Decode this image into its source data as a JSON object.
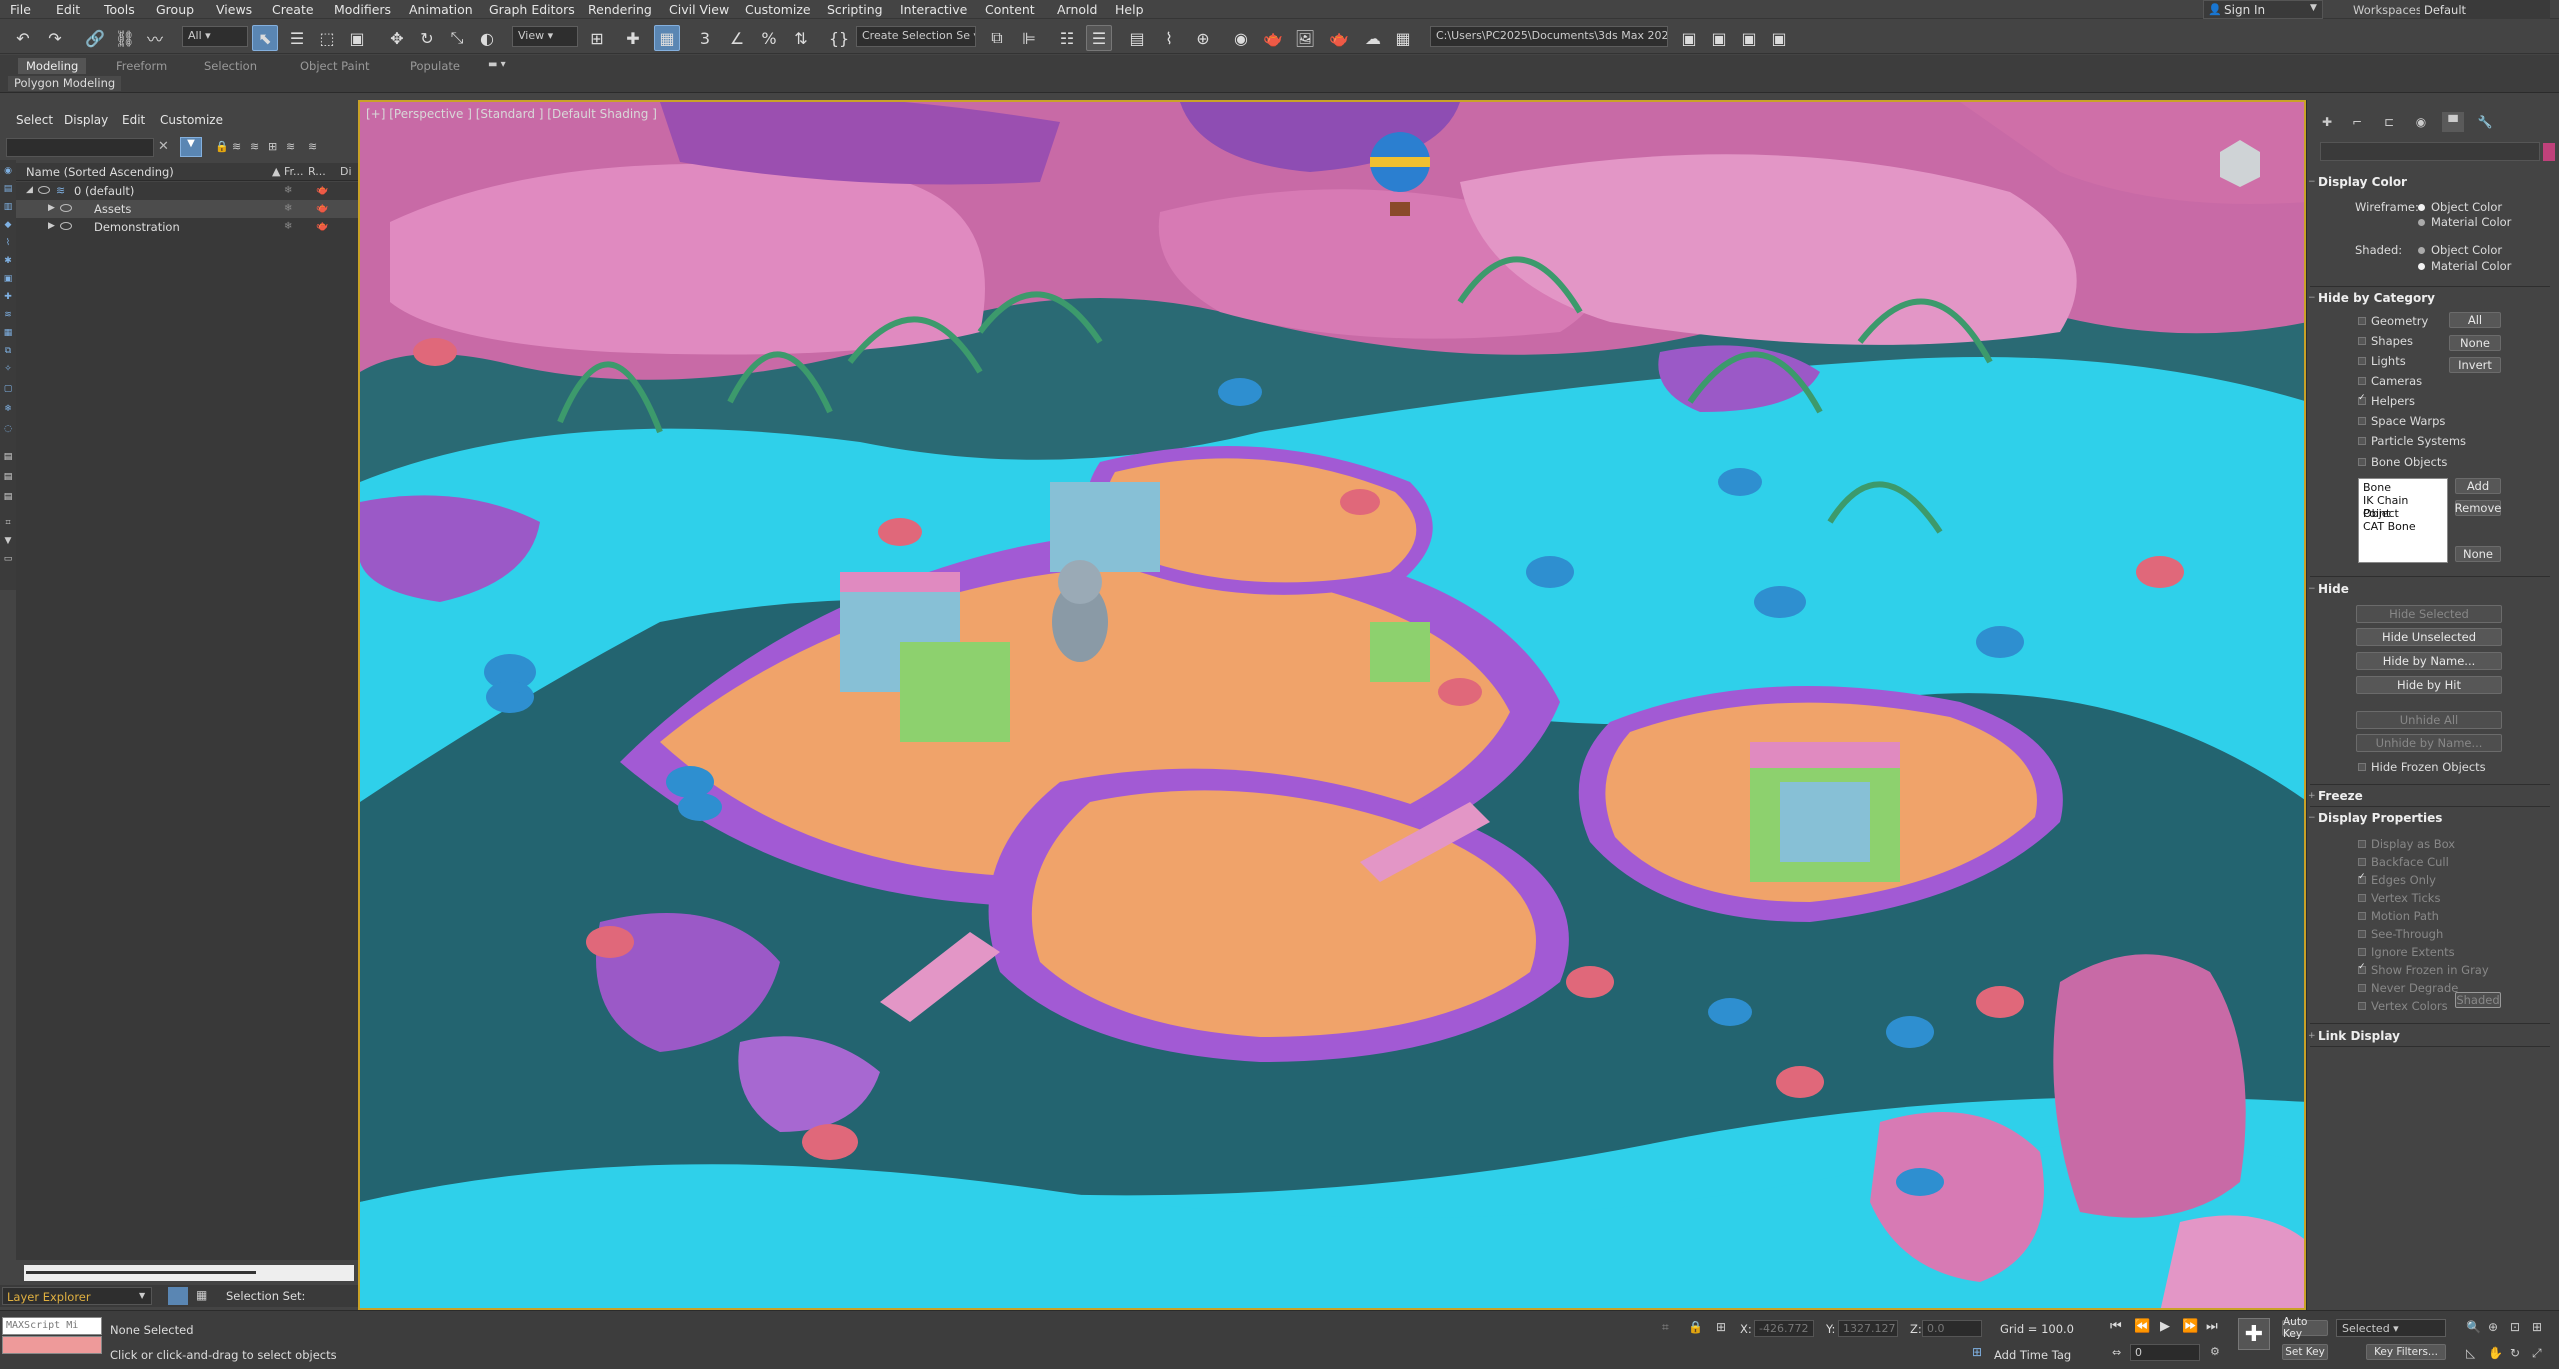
{
  "menubar": {
    "items": [
      "File",
      "Edit",
      "Tools",
      "Group",
      "Views",
      "Create",
      "Modifiers",
      "Animation",
      "Graph Editors",
      "Rendering",
      "Civil View",
      "Customize",
      "Scripting",
      "Interactive",
      "Content",
      "Arnold",
      "Help"
    ],
    "sign_in": "Sign In",
    "workspaces_label": "Workspaces:",
    "workspace": "Default"
  },
  "toolbar": {
    "filter": "All",
    "refcoord": "View",
    "selection_set": "Create Selection Se",
    "project_path": "C:\\Users\\PC2025\\Documents\\3ds Max 2020"
  },
  "ribbon": {
    "tabs": [
      "Modeling",
      "Freeform",
      "Selection",
      "Object Paint",
      "Populate"
    ],
    "sub": "Polygon Modeling"
  },
  "explorer": {
    "menu": [
      "Select",
      "Display",
      "Edit",
      "Customize"
    ],
    "header": "Name (Sorted Ascending)",
    "col_frozen": "▲ Fr...",
    "col_render": "R...",
    "col_display": "Di",
    "rows": [
      {
        "name": "0 (default)",
        "level": 0
      },
      {
        "name": "Assets",
        "level": 1
      },
      {
        "name": "Demonstration",
        "level": 1
      }
    ],
    "layer_explorer": "Layer Explorer",
    "selection_set": "Selection Set:"
  },
  "viewport": {
    "label": "[+] [Perspective ] [Standard ] [Default Shading ]"
  },
  "cmdpanel": {
    "display_color": {
      "title": "Display Color",
      "wireframe": "Wireframe:",
      "shaded": "Shaded:",
      "object_color": "Object Color",
      "material_color": "Material Color"
    },
    "hide_by_category": {
      "title": "Hide by Category",
      "items": [
        "Geometry",
        "Shapes",
        "Lights",
        "Cameras",
        "Helpers",
        "Space Warps",
        "Particle Systems",
        "Bone Objects"
      ],
      "checked_index": 4,
      "all": "All",
      "none": "None",
      "invert": "Invert",
      "list": [
        "Bone",
        "IK Chain Object",
        "Point",
        "CAT Bone"
      ],
      "add": "Add",
      "remove": "Remove",
      "none2": "None"
    },
    "hide": {
      "title": "Hide",
      "hide_selected": "Hide Selected",
      "hide_unselected": "Hide Unselected",
      "hide_by_name": "Hide by Name...",
      "hide_by_hit": "Hide by Hit",
      "unhide_all": "Unhide All",
      "unhide_by_name": "Unhide by Name...",
      "hide_frozen": "Hide Frozen Objects"
    },
    "freeze": {
      "title": "Freeze"
    },
    "display_properties": {
      "title": "Display Properties",
      "items": [
        "Display as Box",
        "Backface Cull",
        "Edges Only",
        "Vertex Ticks",
        "Motion Path",
        "See-Through",
        "Ignore Extents",
        "Show Frozen in Gray",
        "Never Degrade",
        "Vertex Colors"
      ],
      "shaded_btn": "Shaded"
    },
    "link_display": {
      "title": "Link Display"
    }
  },
  "statusbar": {
    "maxscript": "MAXScript Mi",
    "none_selected": "None Selected",
    "prompt": "Click or click-and-drag to select objects",
    "x_label": "X:",
    "x": "-426.772",
    "y_label": "Y:",
    "y": "1327.127",
    "z_label": "Z:",
    "z": "0.0",
    "grid": "Grid = 100.0",
    "add_time_tag": "Add Time Tag",
    "auto_key": "Auto Key",
    "set_key": "Set Key",
    "selected": "Selected",
    "frame": "0",
    "key_filters": "Key Filters..."
  }
}
